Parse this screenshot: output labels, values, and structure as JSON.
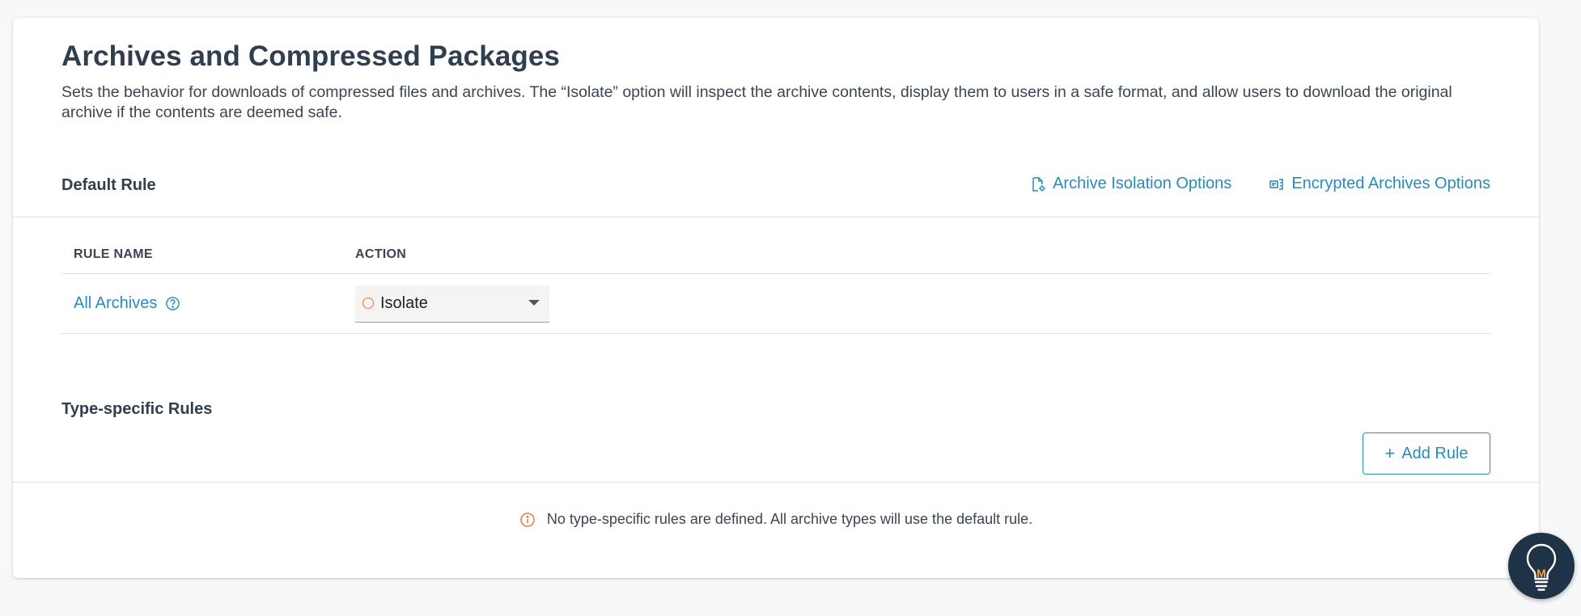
{
  "header": {
    "title": "Archives and Compressed Packages",
    "description": "Sets the behavior for downloads of compressed files and archives. The “Isolate” option will inspect the archive contents, display them to users in a safe format, and allow users to download the original archive if the contents are deemed safe."
  },
  "default_rule": {
    "label": "Default Rule",
    "links": [
      {
        "label": "Archive Isolation Options",
        "icon": "file-settings-icon"
      },
      {
        "label": "Encrypted Archives Options",
        "icon": "encrypted-archive-icon"
      }
    ],
    "table": {
      "columns": [
        "RULE NAME",
        "ACTION"
      ],
      "rows": [
        {
          "name": "All Archives",
          "action": "Isolate",
          "action_status_color": "#e8743b"
        }
      ]
    }
  },
  "type_specific": {
    "label": "Type-specific Rules",
    "add_button": "Add Rule",
    "empty_message": "No type-specific rules are defined. All archive types will use the default rule."
  },
  "fab": {
    "icon": "lightbulb-help-icon",
    "letter": "M"
  },
  "colors": {
    "link": "#2b8ab8",
    "warning": "#e8743b",
    "fab_bg": "#1f3346"
  }
}
